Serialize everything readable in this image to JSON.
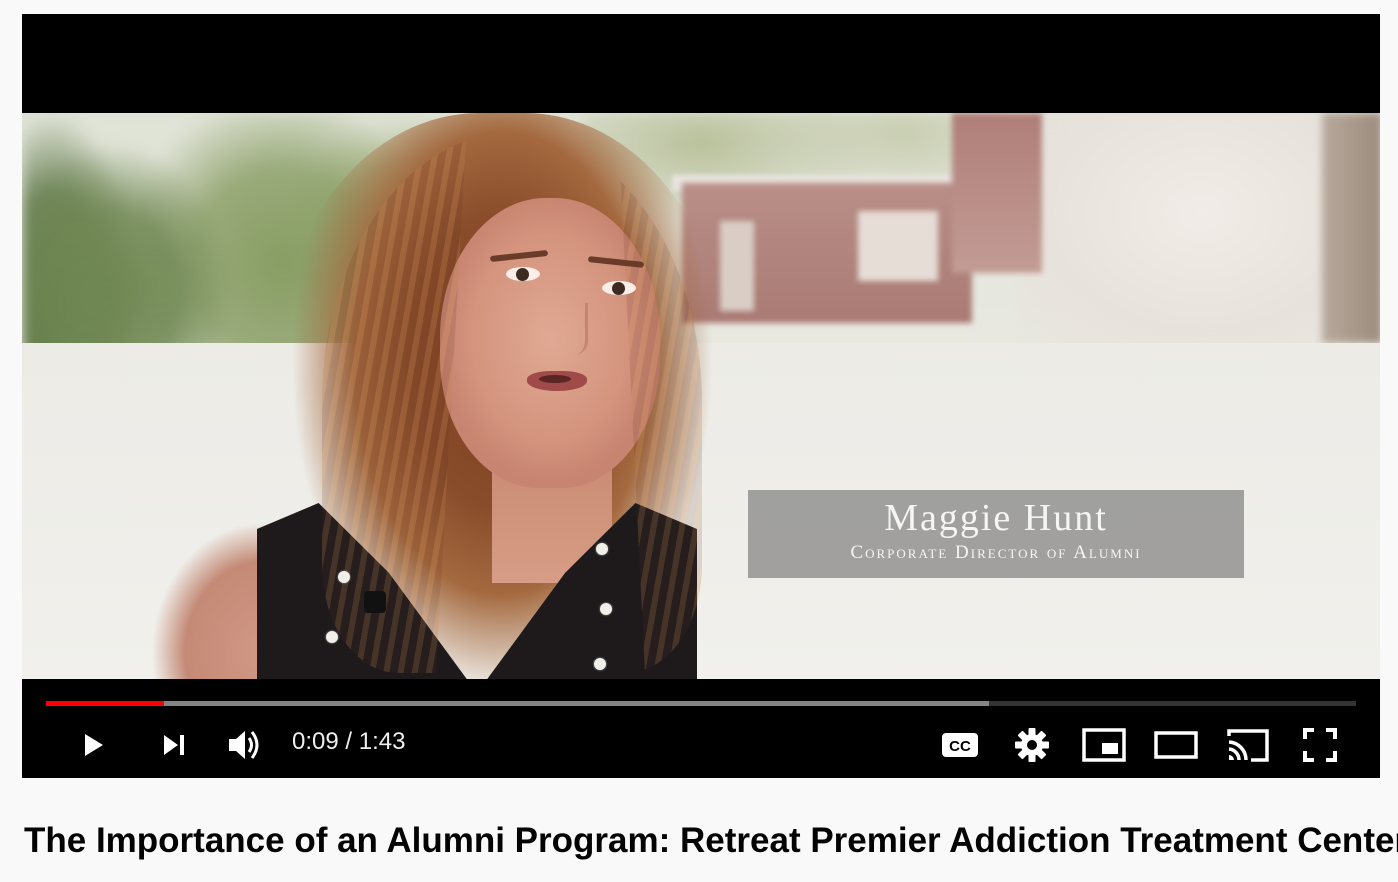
{
  "video": {
    "overlay": {
      "name": "Maggie Hunt",
      "role": "Corporate Director of Alumni"
    },
    "progress": {
      "played_fraction": 0.09,
      "buffered_fraction": 0.72
    },
    "time": {
      "current": "0:09",
      "separator": "/",
      "duration": "1:43"
    },
    "controls": {
      "play_icon": "play-icon",
      "next_icon": "next-icon",
      "volume_icon": "volume-icon",
      "captions_icon": "cc-icon",
      "settings_icon": "gear-icon",
      "miniplayer_icon": "miniplayer-icon",
      "theater_icon": "theater-icon",
      "cast_icon": "cast-icon",
      "fullscreen_icon": "fullscreen-icon"
    },
    "colors": {
      "progress_played": "#ff0000",
      "control_icon": "#ffffff"
    }
  },
  "title": "The Importance of an Alumni Program: Retreat Premier Addiction Treatment Centers"
}
